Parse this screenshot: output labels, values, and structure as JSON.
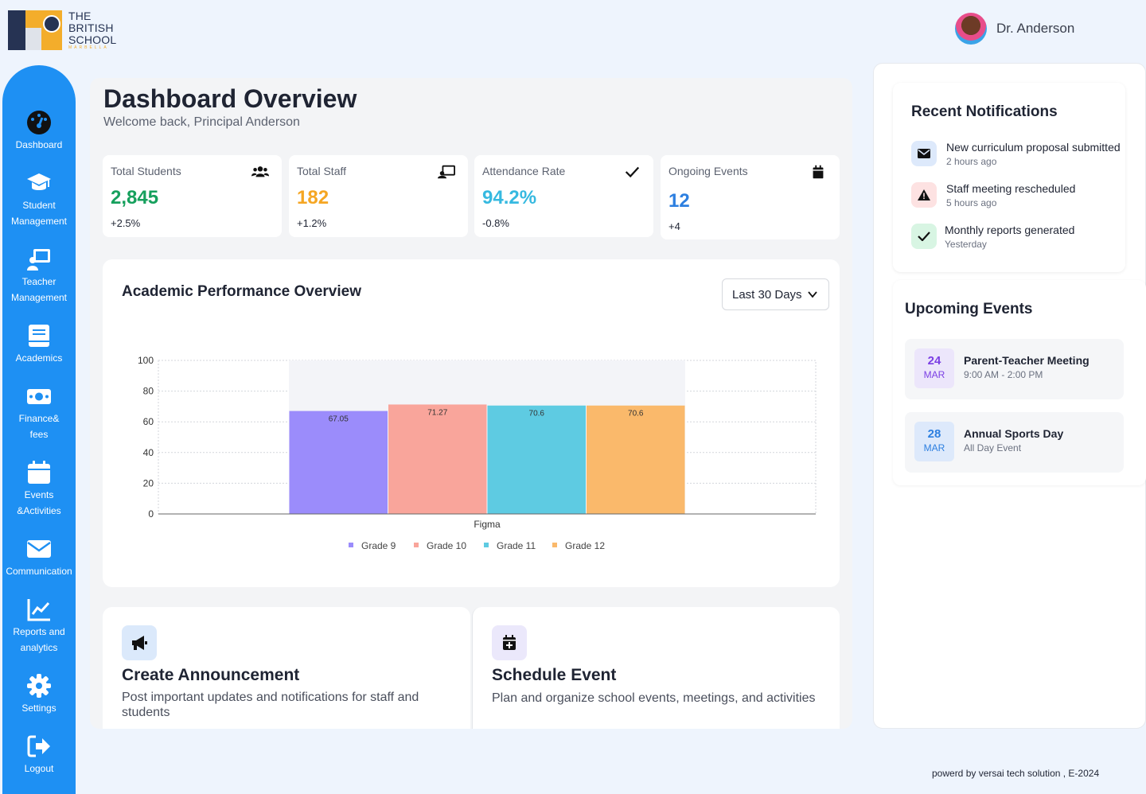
{
  "brand": {
    "line1": "THE",
    "line2": "BRITISH",
    "line3": "SCHOOL",
    "subline": "MARBELLA"
  },
  "user": {
    "name": "Dr. Anderson"
  },
  "sidebar": {
    "items": [
      {
        "label": "Dashboard",
        "icon": "dashboard-gauge-icon"
      },
      {
        "label": "Student Management",
        "icon": "graduation-cap-icon"
      },
      {
        "label": "Teacher Management",
        "icon": "teacher-board-icon"
      },
      {
        "label": "Academics",
        "icon": "book-icon"
      },
      {
        "label": "Finance& fees",
        "icon": "money-icon"
      },
      {
        "label": "Events &Activities",
        "icon": "calendar-icon"
      },
      {
        "label": "Communication",
        "icon": "envelope-icon"
      },
      {
        "label": "Reports and analytics",
        "icon": "line-chart-icon"
      },
      {
        "label": "Settings",
        "icon": "gear-icon"
      },
      {
        "label": "Logout",
        "icon": "logout-icon"
      }
    ]
  },
  "page": {
    "title": "Dashboard Overview",
    "subtitle": "Welcome back, Principal Anderson"
  },
  "stats": [
    {
      "label": "Total Students",
      "value": "2,845",
      "change": "+2.5%",
      "color": "#16a05d",
      "icon": "users-icon"
    },
    {
      "label": "Total Staff",
      "value": "182",
      "change": "+1.2%",
      "color": "#f5a623",
      "icon": "teacher-board-icon"
    },
    {
      "label": "Attendance Rate",
      "value": "94.2%",
      "change": "-0.8%",
      "color": "#36b9e0",
      "icon": "check-icon"
    },
    {
      "label": "Ongoing Events",
      "value": "12",
      "change": "+4",
      "color": "#2d7fe0",
      "icon": "calendar-icon"
    }
  ],
  "performance": {
    "title": "Academic Performance Overview",
    "range": "Last 30 Days"
  },
  "chart_data": {
    "type": "bar",
    "categories": [
      "Figma"
    ],
    "xlabel": "Figma",
    "ylim": [
      0,
      100
    ],
    "yticks": [
      0,
      20,
      40,
      60,
      80,
      100
    ],
    "grid": true,
    "legend_position": "bottom",
    "series": [
      {
        "name": "Grade 9",
        "values": [
          67.05
        ],
        "color": "#9b8cfb",
        "label": "67.05"
      },
      {
        "name": "Grade 10",
        "values": [
          71.27
        ],
        "color": "#f9a59b",
        "label": "71.27"
      },
      {
        "name": "Grade 11",
        "values": [
          70.6
        ],
        "color": "#5ecbe2",
        "label": "70.6"
      },
      {
        "name": "Grade 12",
        "values": [
          70.6
        ],
        "color": "#fab96b",
        "label": "70.6"
      }
    ]
  },
  "actions": [
    {
      "title": "Create Announcement",
      "description": "Post important updates and notifications for staff and students",
      "icon": "megaphone-icon"
    },
    {
      "title": "Schedule Event",
      "description": "Plan and organize school events, meetings, and activities",
      "icon": "calendar-plus-icon"
    }
  ],
  "notifications": {
    "title": "Recent Notifications",
    "items": [
      {
        "text": "New curriculum proposal submitted",
        "time": "2 hours ago",
        "icon": "envelope-icon",
        "bg": "#dde9fb"
      },
      {
        "text": "Staff meeting rescheduled",
        "time": "5 hours ago",
        "icon": "warning-icon",
        "bg": "#fde2e2"
      },
      {
        "text": "Monthly reports generated",
        "time": "Yesterday",
        "icon": "check-icon",
        "bg": "#d8f5e3"
      }
    ]
  },
  "events": {
    "title": "Upcoming Events",
    "items": [
      {
        "day": "24",
        "month": "MAR",
        "title": "Parent-Teacher Meeting",
        "time": "9:00 AM - 2:00 PM",
        "color": "#7b3fe4",
        "bg": "#ece6fb"
      },
      {
        "day": "28",
        "month": "MAR",
        "title": "Annual Sports Day",
        "time": "All Day Event",
        "color": "#2d7fe0",
        "bg": "#dde9fb"
      }
    ]
  },
  "footer": {
    "text": "powerd by versai tech solution , E-2024"
  }
}
